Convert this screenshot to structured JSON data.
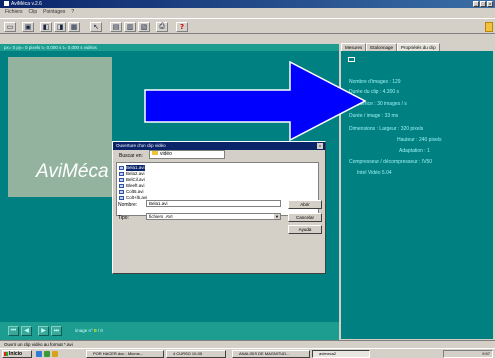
{
  "window": {
    "title": "AviMéca v.2.6",
    "controls": [
      "_",
      "□",
      "x"
    ]
  },
  "menu": [
    "Fichiers",
    "Clip",
    "Pointages",
    "?"
  ],
  "toolbar": {
    "help_label": "?"
  },
  "status_strip": "px= 0   py= 0 pixels   t= 0,000 s   t= 0,000 s vidéos",
  "logo": "AviMéca",
  "dialog": {
    "title": "Ouverture d'un clip vidéo",
    "close_label": "x",
    "lookin_label": "Buscar en:",
    "lookin_value": "vidéo",
    "files": [
      "Bela1.avi",
      "Bela2.avi",
      "BelCil.avi",
      "Bleeft.avi",
      "Colt5.avi",
      "Colt+lb.avi"
    ],
    "name_label": "Nombre:",
    "name_value": "Bela1.avi",
    "type_label": "Tipo:",
    "type_value": "fichiers .AVI",
    "open_button": "Abrir",
    "cancel_button": "Cancelar",
    "help_button": "Ayuda"
  },
  "bottom": {
    "image_label": "image n°",
    "image_value": "0",
    "image_sep": "/",
    "image_total": "0"
  },
  "panel": {
    "tabs": [
      "Mesures",
      "Etalonnage",
      "Propriétés du clip"
    ],
    "active_tab": 2,
    "props": {
      "nb_images": "Nombre d'images : 129",
      "duration": "Durée du clip : 4.300 s",
      "frequency": "Fréquence : 30 images / s",
      "image_duration": "Durée / image : 33 ms",
      "dims": "Dimensions : Largeur : 320 pixels",
      "height": "Hauteur : 240 pixels",
      "adaptation": "Adaptation : 1",
      "compression": "Compresseur / décompresseur : IV50",
      "codec": "Intel Vidéo 5.04"
    }
  },
  "statusline": "Ouvrir un clip vidéo au format *.avi",
  "taskbar": {
    "start": "Inicio",
    "tasks": [
      "POR HACER.doc - Micros...",
      "4 CURSO 10-05",
      "ANALISIS DE MAGNITUD...",
      "avimeca2"
    ],
    "tray_time": "9:57"
  },
  "colors": {
    "teal": "#008080",
    "arrow_blue": "#0000ff",
    "prop_text": "#9ff2f8"
  }
}
